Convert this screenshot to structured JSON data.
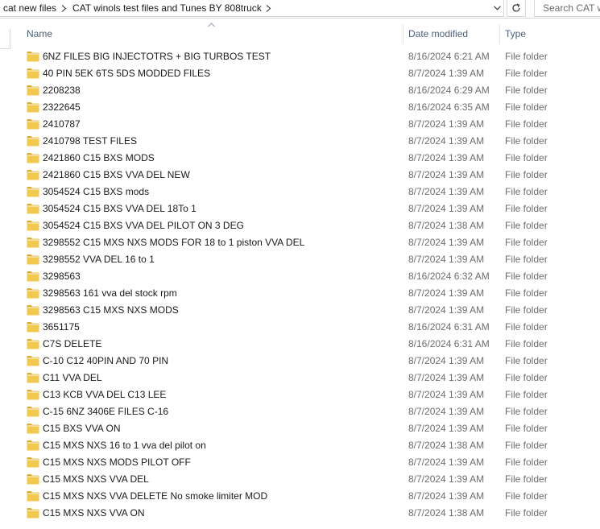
{
  "address_bar": {
    "crumbs": [
      "cat new files",
      "CAT winols test files and Tunes BY 808truck"
    ]
  },
  "search": {
    "placeholder": "Search CAT w"
  },
  "columns": {
    "name": "Name",
    "date_modified": "Date modified",
    "type": "Type"
  },
  "colors": {
    "folder_yellow": "#f2c94c",
    "folder_dark": "#dcaa2c",
    "header_text": "#4c607a"
  },
  "files": [
    {
      "name": "6NZ FILES BIG INJECTOTRS + BIG TURBOS TEST",
      "date": "8/16/2024 6:21 AM",
      "type": "File folder"
    },
    {
      "name": "40 PIN 5EK 6TS 5DS MODDED FILES",
      "date": "8/7/2024 1:39 AM",
      "type": "File folder"
    },
    {
      "name": "2208238",
      "date": "8/16/2024 6:29 AM",
      "type": "File folder"
    },
    {
      "name": "2322645",
      "date": "8/16/2024 6:35 AM",
      "type": "File folder"
    },
    {
      "name": "2410787",
      "date": "8/7/2024 1:39 AM",
      "type": "File folder"
    },
    {
      "name": "2410798 TEST FILES",
      "date": "8/7/2024 1:39 AM",
      "type": "File folder"
    },
    {
      "name": "2421860 C15 BXS MODS",
      "date": "8/7/2024 1:39 AM",
      "type": "File folder"
    },
    {
      "name": "2421860 C15 BXS VVA DEL NEW",
      "date": "8/7/2024 1:39 AM",
      "type": "File folder"
    },
    {
      "name": "3054524 C15 BXS mods",
      "date": "8/7/2024 1:39 AM",
      "type": "File folder"
    },
    {
      "name": "3054524 C15 BXS VVA DEL 18To 1",
      "date": "8/7/2024 1:39 AM",
      "type": "File folder"
    },
    {
      "name": "3054524 C15 BXS VVA DEL PILOT ON 3 DEG",
      "date": "8/7/2024 1:38 AM",
      "type": "File folder"
    },
    {
      "name": "3298552 C15 MXS NXS MODS FOR 18 to 1 piston VVA DEL",
      "date": "8/7/2024 1:39 AM",
      "type": "File folder"
    },
    {
      "name": "3298552 VVA DEL 16 to 1",
      "date": "8/7/2024 1:39 AM",
      "type": "File folder"
    },
    {
      "name": "3298563",
      "date": "8/16/2024 6:32 AM",
      "type": "File folder"
    },
    {
      "name": "3298563 161 vva del stock rpm",
      "date": "8/7/2024 1:39 AM",
      "type": "File folder"
    },
    {
      "name": "3298563 C15 MXS NXS MODS",
      "date": "8/7/2024 1:39 AM",
      "type": "File folder"
    },
    {
      "name": "3651175",
      "date": "8/16/2024 6:31 AM",
      "type": "File folder"
    },
    {
      "name": "C7S DELETE",
      "date": "8/16/2024 6:31 AM",
      "type": "File folder"
    },
    {
      "name": "C-10 C12 40PIN AND 70 PIN",
      "date": "8/7/2024 1:39 AM",
      "type": "File folder"
    },
    {
      "name": "C11 VVA DEL",
      "date": "8/7/2024 1:39 AM",
      "type": "File folder"
    },
    {
      "name": "C13 KCB VVA DEL C13 LEE",
      "date": "8/7/2024 1:39 AM",
      "type": "File folder"
    },
    {
      "name": "C-15 6NZ 3406E FILES C-16",
      "date": "8/7/2024 1:39 AM",
      "type": "File folder"
    },
    {
      "name": "C15 BXS VVA ON",
      "date": "8/7/2024 1:39 AM",
      "type": "File folder"
    },
    {
      "name": "C15 MXS NXS 16 to 1 vva del pilot on",
      "date": "8/7/2024 1:38 AM",
      "type": "File folder"
    },
    {
      "name": "C15 MXS NXS MODS PILOT OFF",
      "date": "8/7/2024 1:39 AM",
      "type": "File folder"
    },
    {
      "name": "C15 MXS NXS VVA DEL",
      "date": "8/7/2024 1:39 AM",
      "type": "File folder"
    },
    {
      "name": "C15 MXS NXS VVA DELETE No smoke limiter MOD",
      "date": "8/7/2024 1:39 AM",
      "type": "File folder"
    },
    {
      "name": "C15 MXS NXS VVA ON",
      "date": "8/7/2024 1:38 AM",
      "type": "File folder"
    }
  ]
}
